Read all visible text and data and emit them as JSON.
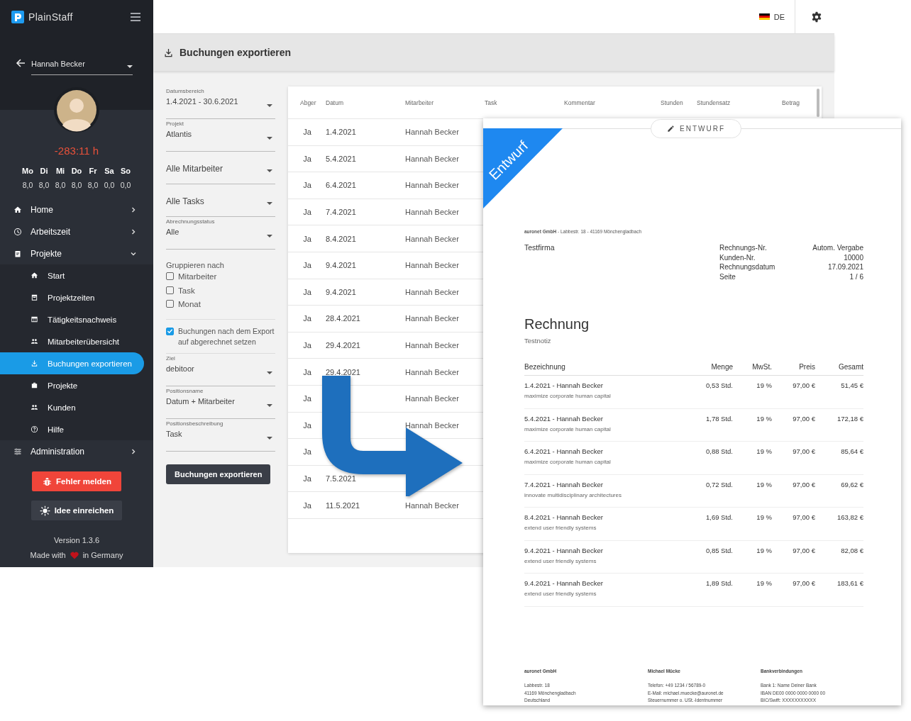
{
  "app": {
    "name": "PlainStaff"
  },
  "topbar": {
    "language": "DE"
  },
  "sidebar": {
    "user": "Hannah Becker",
    "balance": "-283:11 h",
    "days": [
      {
        "day": "Mo",
        "hours": "8,0"
      },
      {
        "day": "Di",
        "hours": "8,0"
      },
      {
        "day": "Mi",
        "hours": "8,0"
      },
      {
        "day": "Do",
        "hours": "8,0"
      },
      {
        "day": "Fr",
        "hours": "8,0"
      },
      {
        "day": "Sa",
        "hours": "0,0"
      },
      {
        "day": "So",
        "hours": "0,0"
      }
    ],
    "nav": [
      {
        "label": "Home",
        "selected": false,
        "expanded": false
      },
      {
        "label": "Arbeitszeit",
        "selected": false,
        "expanded": false
      },
      {
        "label": "Projekte",
        "selected": false,
        "expanded": true,
        "children": [
          {
            "label": "Start",
            "selected": false
          },
          {
            "label": "Projektzeiten",
            "selected": false
          },
          {
            "label": "Tätigkeitsnachweis",
            "selected": false
          },
          {
            "label": "Mitarbeiterübersicht",
            "selected": false
          },
          {
            "label": "Buchungen exportieren",
            "selected": true
          },
          {
            "label": "Projekte",
            "selected": false
          },
          {
            "label": "Kunden",
            "selected": false
          },
          {
            "label": "Hilfe",
            "selected": false
          }
        ]
      },
      {
        "label": "Administration",
        "selected": false,
        "expanded": false
      }
    ],
    "report_button": "Fehler melden",
    "idea_button": "Idee einreichen",
    "version": "Version 1.3.6",
    "made_with": "Made with",
    "made_in": "in Germany"
  },
  "page": {
    "title": "Buchungen exportieren"
  },
  "filters": {
    "fields": [
      {
        "label": "Datumsbereich",
        "value": "1.4.2021 - 30.6.2021"
      },
      {
        "label": "Projekt",
        "value": "Atlantis"
      },
      {
        "value": "Alle Mitarbeiter"
      },
      {
        "value": "Alle Tasks"
      },
      {
        "label": "Abrechnungsstatus",
        "value": "Alle"
      }
    ],
    "group_label": "Gruppieren nach",
    "group_options": [
      {
        "label": "Mitarbeiter",
        "checked": false
      },
      {
        "label": "Task",
        "checked": false
      },
      {
        "label": "Monat",
        "checked": false
      }
    ],
    "mark_billed": {
      "label": "Buchungen nach dem Export auf abgerechnet setzen",
      "checked": true
    },
    "export_fields": [
      {
        "label": "Ziel",
        "value": "debitoor"
      },
      {
        "label": "Positionsname",
        "value": "Datum + Mitarbeiter"
      },
      {
        "label": "Positionsbeschreibung",
        "value": "Task"
      }
    ],
    "button": "Buchungen exportieren"
  },
  "table": {
    "columns": [
      "Abger",
      "Datum",
      "Mitarbeiter",
      "Task",
      "Kommentar",
      "Stunden",
      "Stundensatz",
      "Betrag"
    ],
    "rows": [
      {
        "billed": "Ja",
        "date": "1.4.2021",
        "employee": "Hannah Becker"
      },
      {
        "billed": "Ja",
        "date": "5.4.2021",
        "employee": "Hannah Becker"
      },
      {
        "billed": "Ja",
        "date": "6.4.2021",
        "employee": "Hannah Becker"
      },
      {
        "billed": "Ja",
        "date": "7.4.2021",
        "employee": "Hannah Becker"
      },
      {
        "billed": "Ja",
        "date": "8.4.2021",
        "employee": "Hannah Becker"
      },
      {
        "billed": "Ja",
        "date": "9.4.2021",
        "employee": "Hannah Becker"
      },
      {
        "billed": "Ja",
        "date": "9.4.2021",
        "employee": "Hannah Becker"
      },
      {
        "billed": "Ja",
        "date": "28.4.2021",
        "employee": "Hannah Becker"
      },
      {
        "billed": "Ja",
        "date": "29.4.2021",
        "employee": "Hannah Becker"
      },
      {
        "billed": "Ja",
        "date": "29.4.2021",
        "employee": "Hannah Becker"
      },
      {
        "billed": "Ja",
        "employee": "Hannah Becker"
      },
      {
        "billed": "Ja",
        "employee": "Hannah Becker"
      },
      {
        "billed": "Ja"
      },
      {
        "billed": "Ja",
        "date": "7.5.2021"
      },
      {
        "billed": "Ja",
        "date": "11.5.2021",
        "employee": "Hannah Becker"
      }
    ]
  },
  "invoice": {
    "badge": "ENTWURF",
    "ribbon": "Entwurf",
    "sender_line": "**auronet GmbH** - Labbestr. 18 - 41169 Mönchengladbach",
    "recipient": "Testfirma",
    "meta": [
      {
        "label": "Rechnungs-Nr.",
        "value": "Autom. Vergabe"
      },
      {
        "label": "Kunden-Nr.",
        "value": "10000"
      },
      {
        "label": "Rechnungsdatum",
        "value": "17.09.2021"
      },
      {
        "label": "Seite",
        "value": "1 / 6"
      }
    ],
    "title": "Rechnung",
    "note": "Testnotiz",
    "columns": [
      "Bezeichnung",
      "Menge",
      "MwSt.",
      "Preis",
      "Gesamt"
    ],
    "items": [
      {
        "title": "1.4.2021 - Hannah Becker",
        "description": "maximize corporate human capital",
        "quantity": "0,53 Std.",
        "vat": "19 %",
        "price": "97,00 €",
        "total": "51,45 €"
      },
      {
        "title": "5.4.2021 - Hannah Becker",
        "description": "maximize corporate human capital",
        "quantity": "1,78 Std.",
        "vat": "19 %",
        "price": "97,00 €",
        "total": "172,18 €"
      },
      {
        "title": "6.4.2021 - Hannah Becker",
        "description": "maximize corporate human capital",
        "quantity": "0,88 Std.",
        "vat": "19 %",
        "price": "97,00 €",
        "total": "85,64 €"
      },
      {
        "title": "7.4.2021 - Hannah Becker",
        "description": "innovate multidisciplinary architectures",
        "quantity": "0,72 Std.",
        "vat": "19 %",
        "price": "97,00 €",
        "total": "69,62 €"
      },
      {
        "title": "8.4.2021 - Hannah Becker",
        "description": "extend user friendly systems",
        "quantity": "1,69 Std.",
        "vat": "19 %",
        "price": "97,00 €",
        "total": "163,82 €"
      },
      {
        "title": "9.4.2021 - Hannah Becker",
        "description": "extend user friendly systems",
        "quantity": "0,85 Std.",
        "vat": "19 %",
        "price": "97,00 €",
        "total": "82,08 €"
      },
      {
        "title": "9.4.2021 - Hannah Becker",
        "description": "extend user friendly systems",
        "quantity": "1,89 Std.",
        "vat": "19 %",
        "price": "97,00 €",
        "total": "183,61 €"
      }
    ],
    "footer": [
      {
        "heading": "auronet GmbH",
        "lines": [
          "Labbestr. 18",
          "41169 Mönchengladbach",
          "Deutschland"
        ]
      },
      {
        "heading": "Michael Mücke",
        "lines": [
          "Telefon: +49 1234 / 56789-0",
          "E-Mail: michael.muecke@auronet.de",
          "Steuernummer o. USt.-Identnummer"
        ]
      },
      {
        "heading": "Bankverbindungen",
        "lines": [
          "Bank 1: Name Deiner Bank",
          "IBAN DE00 0000 0000 0000 00",
          "BIC/Swift: XXXXXXXXXXX"
        ]
      }
    ]
  }
}
